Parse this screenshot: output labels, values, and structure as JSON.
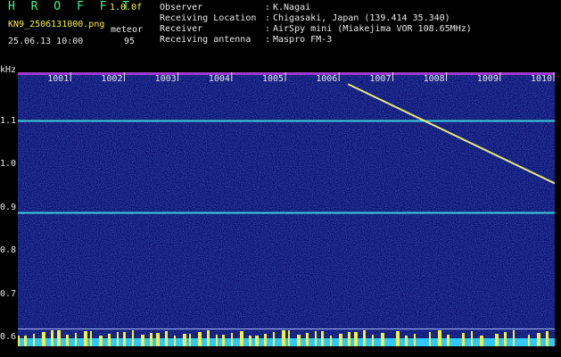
{
  "app": {
    "title": "H R O F F T",
    "version": "1.0.0f"
  },
  "file_name": "KN9_2506131000.png",
  "datetime": "25.06.13 10:00",
  "mode": {
    "label": "meteor",
    "value": "95"
  },
  "meta": [
    {
      "label": "Observer",
      "value": "K.Nagai"
    },
    {
      "label": "Receiving Location",
      "value": "Chigasaki, Japan (139.414 35.340)"
    },
    {
      "label": "Receiver",
      "value": "AirSpy mini (Miakejima VOR 108.65MHz)"
    },
    {
      "label": "Receiving antenna",
      "value": "Maspro FM-3"
    }
  ],
  "chart_data": {
    "type": "heatmap",
    "y_unit_label": "kHz",
    "y_ticks": [
      "1.1",
      "1.0",
      "0.9",
      "0.8",
      "0.7",
      "0.6"
    ],
    "y_tick_values": [
      1.1,
      1.0,
      0.9,
      0.8,
      0.7,
      0.6
    ],
    "ylim": [
      0.58,
      1.2
    ],
    "time_ticks": [
      "1001",
      "1002",
      "1003",
      "1004",
      "1005",
      "1006",
      "1007",
      "1008",
      "1009",
      "1010"
    ],
    "time_range_min": [
      0,
      10
    ],
    "carriers_khz": [
      1.1,
      0.888,
      0.62
    ],
    "trace": {
      "start_min": 6.15,
      "start_khz": 1.185,
      "end_min": 10.0,
      "end_khz": 0.956
    },
    "colors": {
      "background": "#0b0f6e",
      "carrier": "#40e0e8",
      "trace": "#ffff7a",
      "ticks": "#e8e8e8"
    }
  }
}
